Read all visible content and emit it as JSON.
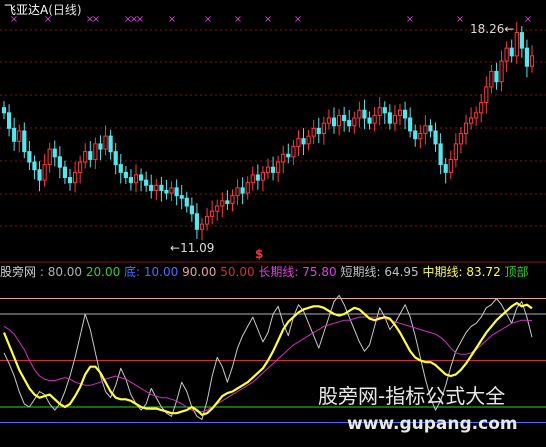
{
  "title": {
    "name": "飞亚达A",
    "period": "(日线)"
  },
  "price_labels": {
    "high": "18.26",
    "low": "11.09",
    "high_arrow": "←",
    "low_arrow": "←"
  },
  "signal": {
    "marker": "$"
  },
  "legend": {
    "name": "股旁网",
    "items": [
      {
        "text": ": 80.00",
        "color": "#b0b0b0"
      },
      {
        "text": "20.00",
        "color": "#30d030"
      },
      {
        "text": "底: 10.00",
        "color": "#4a6cff"
      },
      {
        "text": "90.00",
        "color": "#e8a0a0"
      },
      {
        "text": "50.00",
        "color": "#d03030"
      },
      {
        "text": "长期线: 75.80",
        "color": "#e040e0"
      },
      {
        "text": "短期线: 64.95",
        "color": "#c0c0c0"
      },
      {
        "text": "中期线: 83.72",
        "color": "#ffff40"
      },
      {
        "text": "顶部",
        "color": "#30d030"
      }
    ]
  },
  "watermark": {
    "cn": "股旁网-指标公式大全",
    "url": "www.gupang.com"
  },
  "colors": {
    "up": "#ff3a3a",
    "down": "#55e6ee",
    "grid": "#8a1010",
    "top_marker": "#e040e0",
    "ref_80": "#b0b0b0",
    "ref_90": "#e8a0a0",
    "ref_50": "#d03030",
    "ref_20": "#30d030",
    "ref_10": "#4a6cff",
    "long": "#d030c0",
    "short": "#c8c8c8",
    "mid": "#ffff40"
  },
  "chart_data": [
    {
      "type": "candlestick",
      "title": "飞亚达A (日线)",
      "ylim": [
        10.5,
        19.0
      ],
      "annotations": [
        {
          "label": "18.26",
          "type": "high"
        },
        {
          "label": "11.09",
          "type": "low"
        }
      ],
      "top_markers": "×",
      "close": [
        15.8,
        15.2,
        14.7,
        15.1,
        14.3,
        13.9,
        13.6,
        13.2,
        13.8,
        14.4,
        14.1,
        13.7,
        13.3,
        13.1,
        13.5,
        13.9,
        14.3,
        14.0,
        14.6,
        14.4,
        14.9,
        14.3,
        13.8,
        13.5,
        13.3,
        13.1,
        13.4,
        13.2,
        13.0,
        12.8,
        13.0,
        12.8,
        12.7,
        12.9,
        12.6,
        12.5,
        12.2,
        11.9,
        11.3,
        11.5,
        11.8,
        12.0,
        12.2,
        12.4,
        12.3,
        12.6,
        12.9,
        12.7,
        13.1,
        13.4,
        13.2,
        13.5,
        13.7,
        13.5,
        13.9,
        14.2,
        14.1,
        14.5,
        14.8,
        14.6,
        14.9,
        15.2,
        15.0,
        15.4,
        15.6,
        15.3,
        15.7,
        15.5,
        15.3,
        15.6,
        15.9,
        15.6,
        15.4,
        15.7,
        16.0,
        15.8,
        15.4,
        15.7,
        15.9,
        15.6,
        15.1,
        14.8,
        15.0,
        15.3,
        15.1,
        14.6,
        13.8,
        13.5,
        14.0,
        14.6,
        15.0,
        15.4,
        15.6,
        15.8,
        16.2,
        16.8,
        17.4,
        17.0,
        17.8,
        18.3,
        18.0,
        18.9,
        18.3,
        17.6,
        18.0
      ]
    },
    {
      "type": "line",
      "title": "股旁网",
      "ylim": [
        0,
        100
      ],
      "reference_lines": [
        80,
        20,
        10,
        90,
        50
      ],
      "series": [
        {
          "name": "长期线",
          "values": [
            72,
            70,
            67,
            62,
            57,
            50,
            44,
            40,
            38,
            37,
            37,
            38,
            39,
            38,
            36,
            35,
            34,
            34,
            35,
            36,
            38,
            39,
            40,
            39,
            38,
            36,
            34,
            32,
            30,
            28,
            27,
            26,
            26,
            25,
            24,
            22,
            20,
            18,
            17,
            17,
            18,
            20,
            22,
            24,
            26,
            28,
            30,
            32,
            34,
            36,
            39,
            42,
            45,
            48,
            51,
            54,
            57,
            60,
            62,
            64,
            66,
            68,
            70,
            72,
            73,
            74,
            75,
            76,
            76,
            77,
            78,
            78,
            78,
            78,
            78,
            77,
            76,
            75,
            74,
            73,
            72,
            71,
            70,
            69,
            68,
            67,
            65,
            62,
            58,
            55,
            54,
            54,
            55,
            57,
            60,
            63,
            66,
            68,
            70,
            72,
            74,
            75,
            76,
            76,
            75.8
          ]
        },
        {
          "name": "短期线",
          "values": [
            55,
            48,
            40,
            30,
            22,
            20,
            25,
            30,
            28,
            22,
            18,
            22,
            30,
            40,
            52,
            66,
            80,
            70,
            55,
            40,
            30,
            26,
            34,
            45,
            38,
            28,
            22,
            18,
            22,
            32,
            26,
            20,
            16,
            14,
            24,
            36,
            30,
            20,
            14,
            12,
            24,
            40,
            52,
            46,
            36,
            46,
            58,
            66,
            72,
            78,
            70,
            62,
            68,
            80,
            85,
            74,
            66,
            78,
            86,
            82,
            74,
            66,
            58,
            68,
            78,
            88,
            92,
            86,
            78,
            70,
            62,
            56,
            60,
            72,
            84,
            78,
            70,
            74,
            80,
            86,
            78,
            66,
            52,
            38,
            26,
            18,
            24,
            34,
            46,
            56,
            62,
            68,
            72,
            74,
            78,
            84,
            86,
            90,
            86,
            80,
            74,
            84,
            88,
            78,
            65
          ]
        },
        {
          "name": "中期线",
          "values": [
            68,
            60,
            52,
            44,
            38,
            32,
            28,
            26,
            27,
            28,
            25,
            22,
            20,
            22,
            27,
            33,
            41,
            46,
            46,
            42,
            36,
            30,
            26,
            25,
            25,
            24,
            22,
            20,
            19,
            19,
            19,
            18,
            17,
            16,
            16,
            17,
            18,
            20,
            18,
            15,
            16,
            19,
            23,
            27,
            29,
            30,
            32,
            34,
            36,
            39,
            42,
            45,
            50,
            56,
            63,
            70,
            75,
            78,
            81,
            83,
            84,
            85,
            85,
            84,
            82,
            80,
            79,
            80,
            82,
            84,
            83,
            80,
            77,
            76,
            77,
            78,
            77,
            73,
            68,
            62,
            56,
            52,
            50,
            49,
            49,
            47,
            44,
            41,
            40,
            41,
            44,
            48,
            53,
            58,
            63,
            68,
            72,
            76,
            79,
            82,
            85,
            87,
            85,
            86,
            83.7
          ]
        }
      ]
    }
  ]
}
